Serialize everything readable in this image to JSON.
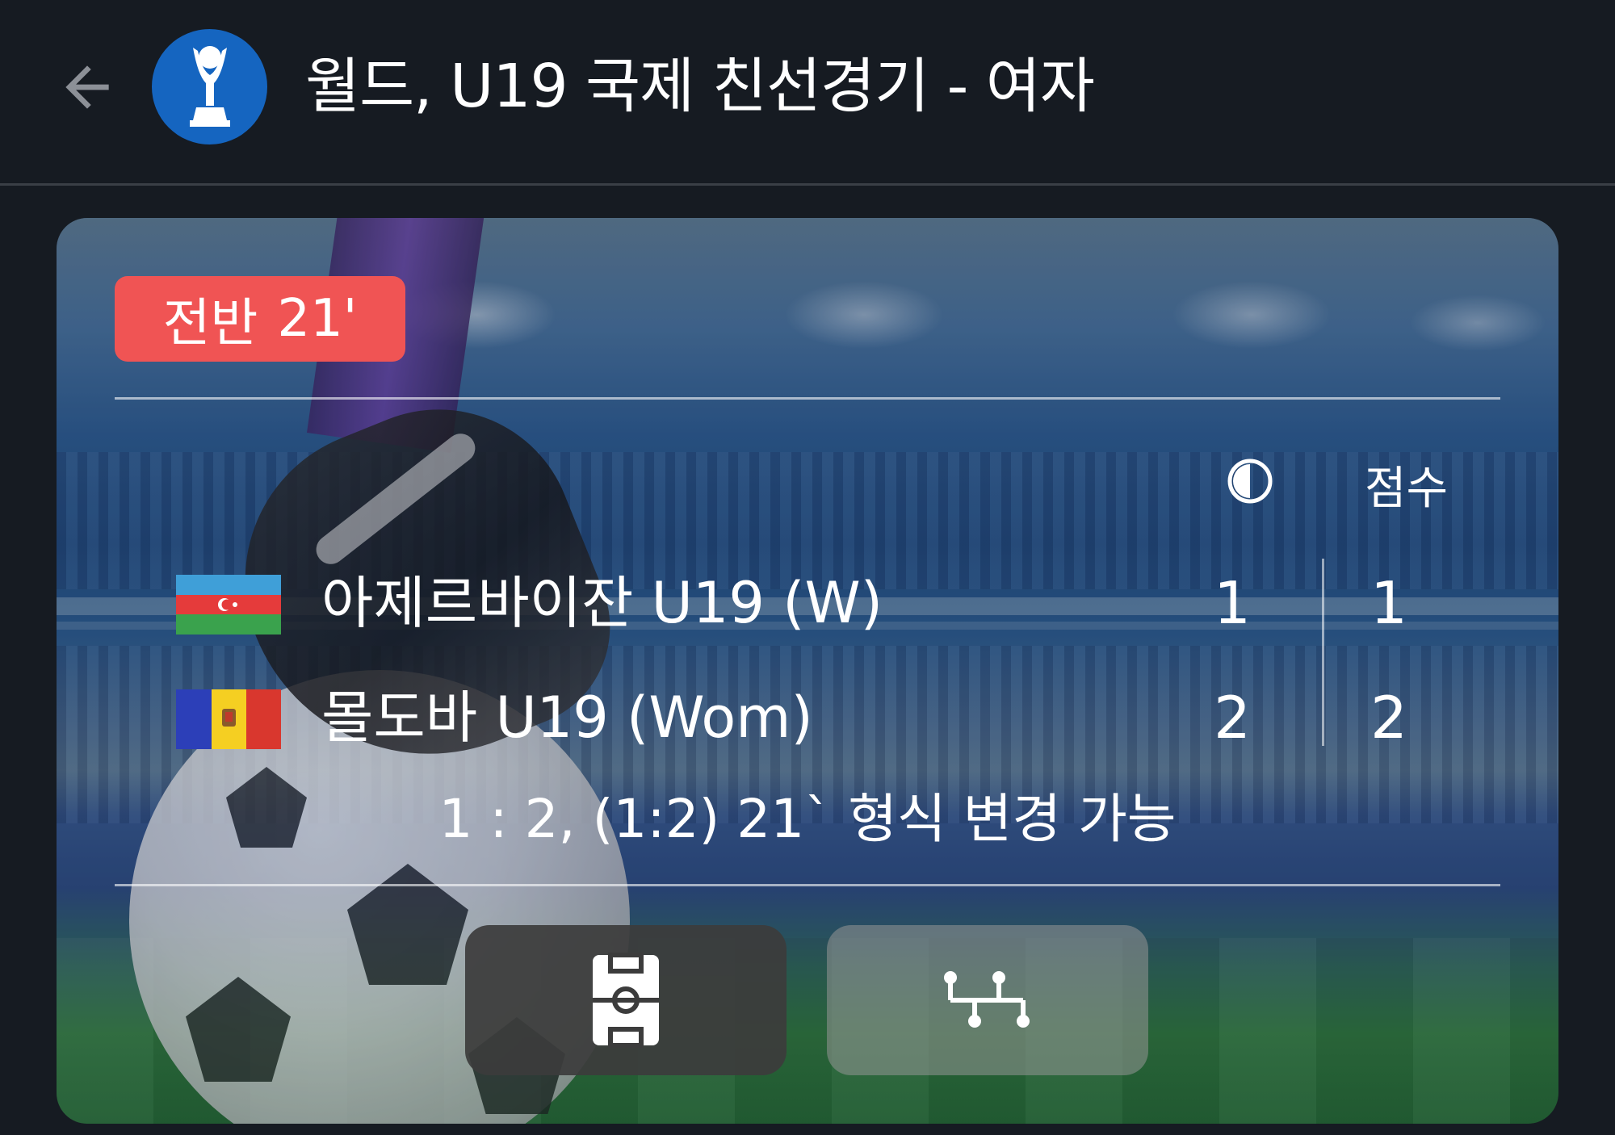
{
  "header": {
    "back_icon": "arrow-left-icon",
    "league_logo_icon": "trophy-icon",
    "title": "월드, U19 국제 친선경기 - 여자"
  },
  "match": {
    "status": {
      "period": "전반",
      "minute": "21'",
      "color": "#f05454"
    },
    "columns": {
      "half_icon": "half-time-icon",
      "score_label": "점수"
    },
    "teams": [
      {
        "name": "아제르바이잔 U19 (W)",
        "flag_icon": "azerbaijan-flag-icon",
        "half_score": "1",
        "score": "1"
      },
      {
        "name": "몰도바 U19 (Wom)",
        "flag_icon": "moldova-flag-icon",
        "half_score": "2",
        "score": "2"
      }
    ],
    "summary": "1 : 2, (1:2) 21` 형식 변경 가능",
    "actions": [
      {
        "icon": "soccer-field-icon"
      },
      {
        "icon": "lineup-formation-icon"
      }
    ]
  },
  "colors": {
    "background": "#161b22",
    "league_logo": "#1565c0",
    "status_pill": "#f05454"
  }
}
